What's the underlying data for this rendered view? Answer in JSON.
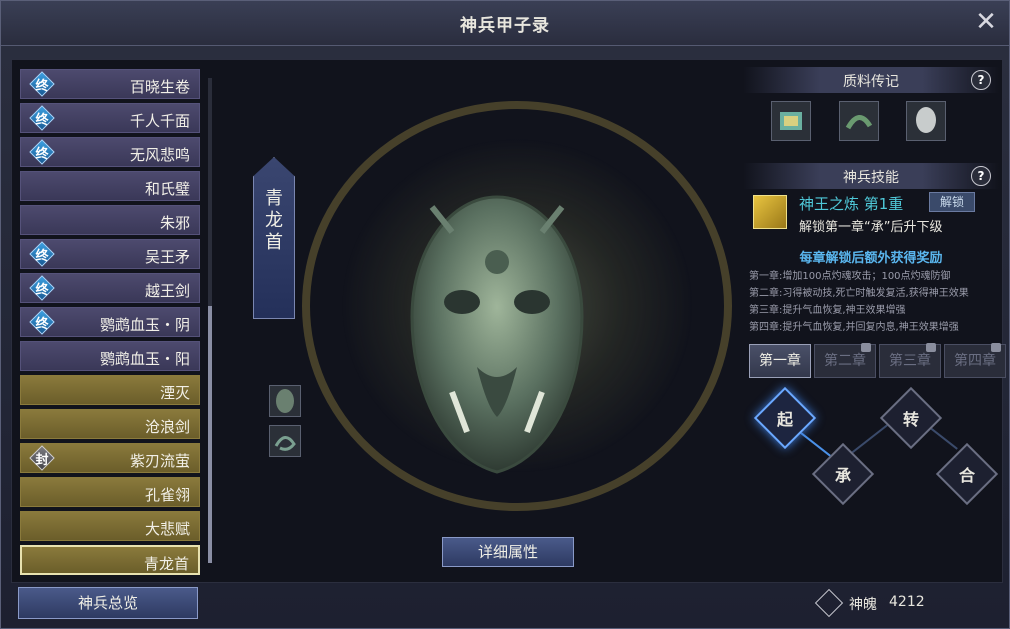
{
  "window": {
    "title": "神兵甲子录",
    "close_icon": "close-icon"
  },
  "weapon_list": [
    {
      "name": "百晓生卷",
      "badge": "终",
      "style": "purple"
    },
    {
      "name": "千人千面",
      "badge": "终",
      "style": "purple"
    },
    {
      "name": "无风悲鸣",
      "badge": "终",
      "style": "purple"
    },
    {
      "name": "和氏璧",
      "badge": "",
      "style": "purple"
    },
    {
      "name": "朱邪",
      "badge": "",
      "style": "purple"
    },
    {
      "name": "吴王矛",
      "badge": "终",
      "style": "purple"
    },
    {
      "name": "越王剑",
      "badge": "终",
      "style": "purple"
    },
    {
      "name": "鹦鹉血玉・阴",
      "badge": "终",
      "style": "purple"
    },
    {
      "name": "鹦鹉血玉・阳",
      "badge": "",
      "style": "purple"
    },
    {
      "name": "湮灭",
      "badge": "",
      "style": "gold"
    },
    {
      "name": "沧浪剑",
      "badge": "",
      "style": "gold"
    },
    {
      "name": "紫刃流萤",
      "badge": "封",
      "style": "gold"
    },
    {
      "name": "孔雀翎",
      "badge": "",
      "style": "gold"
    },
    {
      "name": "大悲赋",
      "badge": "",
      "style": "gold"
    },
    {
      "name": "青龙首",
      "badge": "",
      "style": "gold",
      "selected": true
    }
  ],
  "center": {
    "banner": "青龙首",
    "detail_button": "详细属性"
  },
  "materials": {
    "title": "质料传记",
    "help": "?"
  },
  "skill_section": {
    "title": "神兵技能",
    "help": "?"
  },
  "skill": {
    "name": "神王之炼 第1重",
    "unlock_button": "解锁",
    "desc": "解锁第一章“承”后升下级"
  },
  "rewards": {
    "title": "每章解锁后额外获得奖励",
    "lines": [
      "第一章:增加100点灼魂攻击；100点灼魂防御",
      "第二章:习得被动技,死亡时触发复活,获得神王效果",
      "第三章:提升气血恢复,神王效果增强",
      "第四章:提升气血恢复,并回复内息,神王效果增强"
    ]
  },
  "chapters": [
    {
      "label": "第一章",
      "active": true
    },
    {
      "label": "第二章",
      "active": false
    },
    {
      "label": "第三章",
      "active": false
    },
    {
      "label": "第四章",
      "active": false
    }
  ],
  "nodes": {
    "qi": "起",
    "cheng": "承",
    "zhuan": "转",
    "he": "合"
  },
  "footer": {
    "overview_button": "神兵总览",
    "currency_label": "神魄",
    "currency_value": "4212"
  },
  "colors": {
    "accent_blue": "#4a90e8",
    "gold_item": "#8a7a3c",
    "purple_item": "#4d4a6e",
    "skill_name": "#4fc8d8",
    "reward_title": "#5ab6ee"
  }
}
